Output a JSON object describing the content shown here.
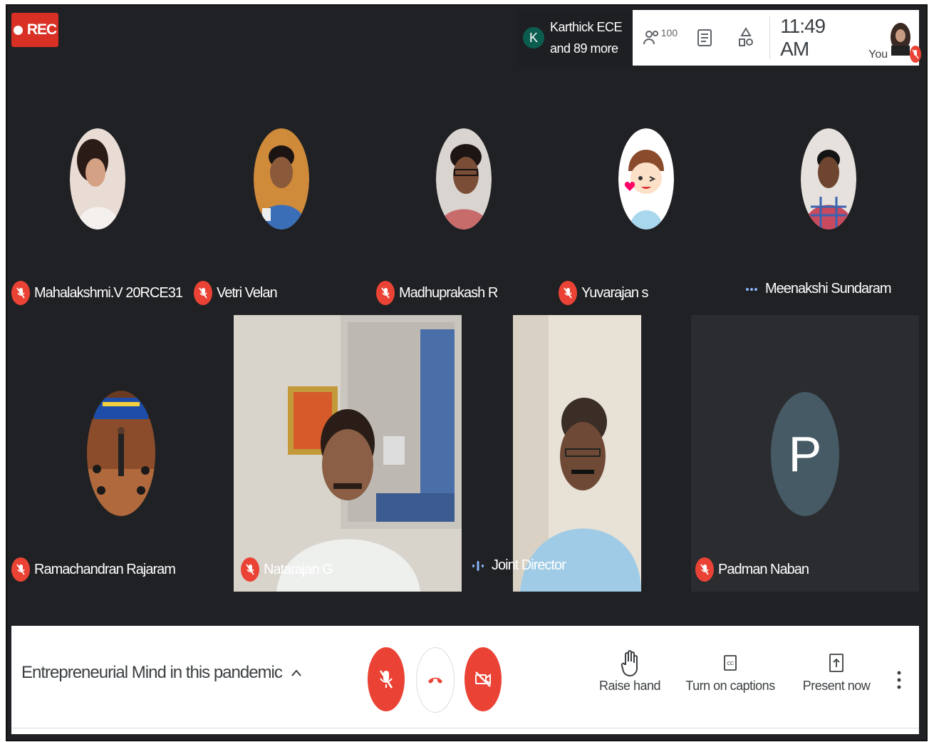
{
  "recording": {
    "label": "REC"
  },
  "presenter": {
    "initial": "K",
    "line1": "Karthick ECE",
    "line2": "and 89 more"
  },
  "topbar": {
    "participants_count": "100",
    "time": "11:49 AM",
    "self_label": "You"
  },
  "participants": [
    {
      "name": "Mahalakshmi.V 20RCE31",
      "mic": "off"
    },
    {
      "name": "Vetri Velan",
      "mic": "off"
    },
    {
      "name": "Madhuprakash R",
      "mic": "off"
    },
    {
      "name": "Yuvarajan s",
      "mic": "off"
    },
    {
      "name": "Meenakshi Sundaram",
      "mic": "more"
    },
    {
      "name": "Ramachandran Rajaram",
      "mic": "off"
    },
    {
      "name": "Natarajan G",
      "mic": "off"
    },
    {
      "name": "Joint Director",
      "mic": "speaking"
    },
    {
      "name": "Padman Naban",
      "mic": "off",
      "initial": "P"
    }
  ],
  "bottom": {
    "meeting_title": "Entrepreneurial Mind in this pandemic",
    "raise_hand": "Raise hand",
    "captions": "Turn on captions",
    "present": "Present now"
  },
  "colors": {
    "accent_red": "#ea4335",
    "rec_red": "#d93025",
    "stage_bg": "#202124",
    "p_avatar": "#455a64"
  }
}
